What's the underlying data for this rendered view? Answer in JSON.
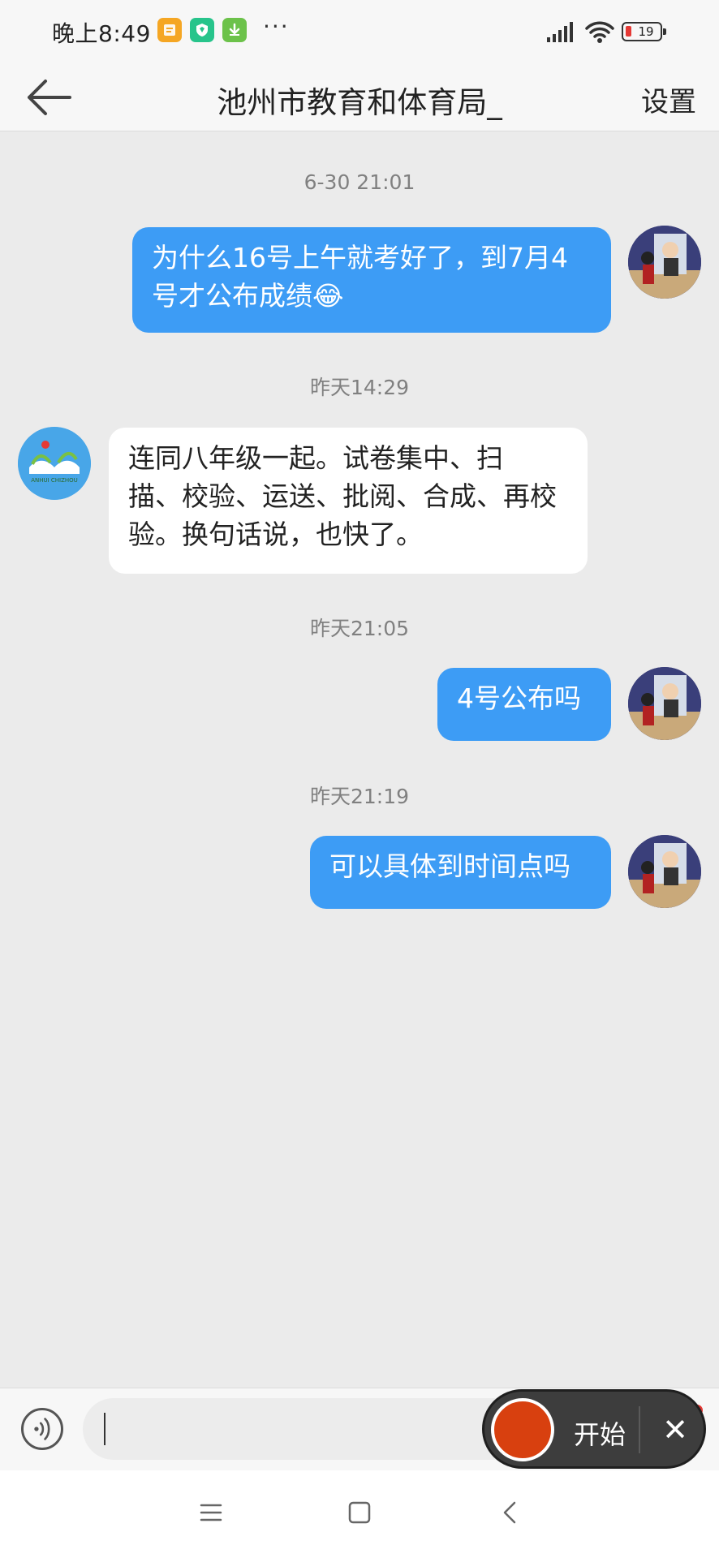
{
  "status_bar": {
    "time": "晚上8:49",
    "more": "···",
    "battery": "19",
    "app_badges": [
      {
        "icon": "notes-app-icon",
        "color": "#f5a623"
      },
      {
        "icon": "shield-app-icon",
        "color": "#27c48b"
      },
      {
        "icon": "download-app-icon",
        "color": "#6cc24a"
      }
    ]
  },
  "header": {
    "title": "池州市教育和体育局_",
    "settings": "设置"
  },
  "messages": [
    {
      "timestamp": "6-30 21:01",
      "side": "out",
      "lines": [
        "为什么16号上午就考好了，到7月4",
        "号才公布成绩😂"
      ]
    },
    {
      "timestamp": "昨天14:29",
      "side": "in",
      "lines": [
        "连同八年级一起。试卷集中、扫",
        "描、校验、运送、批阅、合成、再校",
        "验。换句话说，也快了。"
      ]
    },
    {
      "timestamp": "昨天21:05",
      "side": "out",
      "lines": [
        "4号公布吗"
      ]
    },
    {
      "timestamp": "昨天21:19",
      "side": "out",
      "lines": [
        "可以具体到时间点吗"
      ]
    }
  ],
  "avatars": {
    "bureau_text": "ANHUI CHIZHOU"
  },
  "recorder": {
    "start_label": "开始",
    "close": "✕"
  },
  "colors": {
    "outgoing_bubble": "#3d9cf5",
    "incoming_bubble": "#ffffff",
    "chat_background": "#ebebeb",
    "record_button": "#d8400f"
  }
}
